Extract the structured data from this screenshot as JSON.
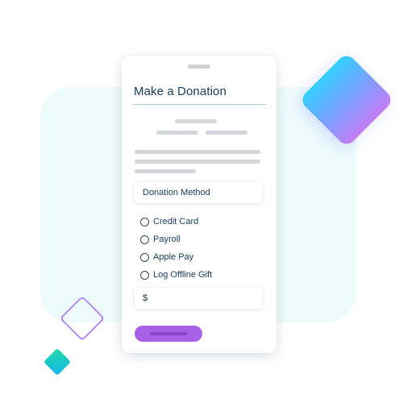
{
  "form": {
    "title": "Make a Donation",
    "method_field_label": "Donation Method",
    "payment_options": [
      {
        "label": "Credit Card",
        "selected": false
      },
      {
        "label": "Payroll",
        "selected": false
      },
      {
        "label": "Apple Pay",
        "selected": false
      },
      {
        "label": "Log Offline Gift",
        "selected": false
      }
    ],
    "amount_prefix": "$",
    "amount_value": ""
  },
  "colors": {
    "title_text": "#163b5a",
    "panel_background": "#eefbfd",
    "submit_button": "#a661e8",
    "accent_gradient": [
      "#33cfff",
      "#c47ef5"
    ]
  }
}
